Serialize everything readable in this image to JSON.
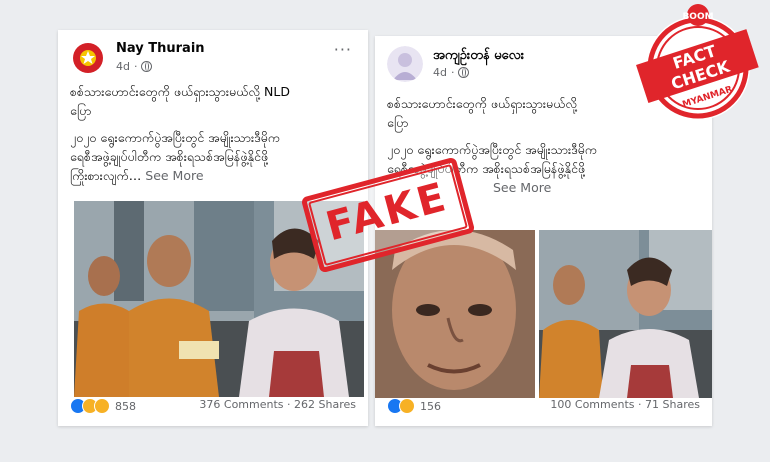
{
  "post1": {
    "username": "Nay Thurain",
    "time": "4d",
    "text_line1": "စစ်သားဟောင်းတွေကို ဖယ်ရှားသွားမယ်လို့ NLD",
    "text_line2": "ပြော",
    "text_line3": "၂၀၂၀ ရွေးကောက်ပွဲအပြီးတွင် အမျိုးသားဒီမိုက",
    "text_line4": "ရေစီအဖွဲ့ချုပ်ပါတီက အစိုးရသစ်အမြန်ဖွဲ့နိုင်ဖို့",
    "text_line5": "ကြိုးစားလျက်…",
    "see_more": "See More",
    "reactions_count": "858",
    "comments": "376 Comments",
    "shares": "262 Shares"
  },
  "post2": {
    "username": "အကျဉ်းတန် မလေး",
    "time": "4d",
    "text_line1": "စစ်သားဟောင်းတွေကို ဖယ်ရှားသွားမယ်လို့",
    "text_line2": "ပြော",
    "text_line3": "၂၀၂၀ ရွေးကောက်ပွဲအပြီးတွင် အမျိုးသားဒီမိုက",
    "text_line4": "ရေစီအဖွဲ့ချုပ်ပါတီက အစိုးရသစ်အမြန်ဖွဲ့နိုင်ဖို့",
    "see_more": "See More",
    "reactions_count": "156",
    "comments": "100 Comments",
    "shares": "71 Shares"
  },
  "stamp": {
    "label": "FAKE"
  },
  "badge": {
    "top": "BOOM",
    "line1": "FACT",
    "line2": "CHECK",
    "bottom": "MYANMAR"
  },
  "colors": {
    "stamp_red": "#e0252b",
    "fb_blue": "#1877f2",
    "meta_gray": "#65676b"
  }
}
